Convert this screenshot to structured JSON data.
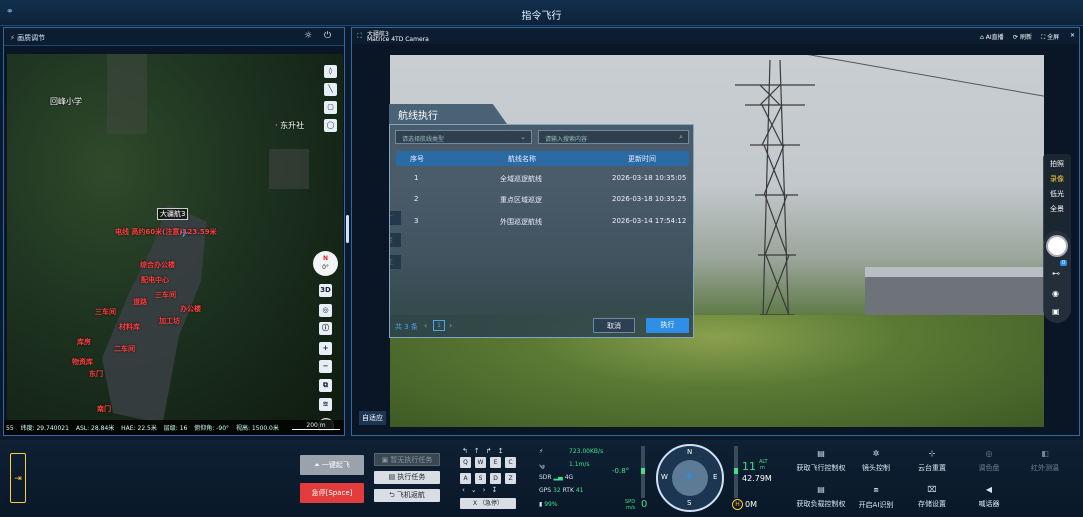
{
  "window": {
    "title": "指令飞行"
  },
  "map_panel": {
    "header_label": "画质调节",
    "labels": {
      "school": "回峰小学",
      "east": "· 东升社",
      "drone": "大疆航3",
      "power_line": "电线 高约60米(注意)123.59米",
      "office": "综合办公楼",
      "distribution": "配电中心",
      "water": "三车间",
      "material": "材料库",
      "tech": "加工坊",
      "admin": "办公楼",
      "warehouse": "库房",
      "road": "道路",
      "park": "二车间",
      "workshop": "三车间",
      "east_gate": "东门",
      "depot": "物资库",
      "south": "南门"
    },
    "compass": {
      "dir": "N",
      "deg": "0°"
    },
    "tools": {
      "three_d": "3D"
    },
    "status": {
      "prefix": "55",
      "lat": "纬度: 29.740021",
      "asl": "ASL: 28.84米",
      "hae": "HAE: 22.5米",
      "level": "层级: 16",
      "pitch": "俯仰角: -90°",
      "range": "视高: 1500.0米",
      "scale": "200 m"
    }
  },
  "camera_panel": {
    "drone_name": "大疆航3",
    "camera_name": "Matrice 4TD Camera",
    "actions": {
      "ai_live": "AI直播",
      "refresh": "刷新",
      "fullscreen": "全屏"
    },
    "side_labels": [
      "广",
      "变",
      "红"
    ],
    "adaptive": "自适应"
  },
  "dialog": {
    "title": "航线执行",
    "type_placeholder": "请选择航线类型",
    "search_placeholder": "请输入搜索内容",
    "columns": [
      "序号",
      "航线名称",
      "更新时间"
    ],
    "rows": [
      [
        "1",
        "全域巡逻航线",
        "2026-03-18 10:35:05"
      ],
      [
        "2",
        "重点区域巡逻",
        "2026-03-18 10:35:25"
      ],
      [
        "3",
        "外围巡逻航线",
        "2026-03-14 17:54:12"
      ]
    ],
    "total": "共 3 条",
    "page": "1",
    "cancel": "取消",
    "execute": "执行"
  },
  "camera_modes": {
    "items": [
      "拍照",
      "录像",
      "低光",
      "全景"
    ],
    "active": "录像",
    "zoom_badge": "0"
  },
  "bottom": {
    "takeoff": "一键起飞",
    "emergency": "急停[Space]",
    "pause_task": "暂无执行任务",
    "exec_task": "执行任务",
    "return": "飞机返航",
    "keys": {
      "row1": [
        "Q",
        "W",
        "E",
        "C"
      ],
      "row2": [
        "A",
        "S",
        "D",
        "Z"
      ],
      "x_label": "X （急停）"
    },
    "telemetry": {
      "speed": "723.00KB/s",
      "wind": "1.1m/s",
      "sdr": "SDR",
      "net": "4G",
      "gps": "GPS",
      "gps_count": "32",
      "rtk": "RTK",
      "rtk_count": "41",
      "battery": "99%"
    },
    "attitude": {
      "pitch": "-0.8°",
      "spd_label": "SPD",
      "spd_unit": "m/s",
      "spd": "0",
      "alt": "11",
      "alt_label": "ALT",
      "alt_unit": "m",
      "distance": "42.79M",
      "home": "0M",
      "compass_letters": [
        "N",
        "E",
        "S",
        "W"
      ]
    },
    "controls": [
      {
        "label": "获取飞行控制权",
        "dim": false,
        "icon": "▤"
      },
      {
        "label": "镜头控制",
        "dim": false,
        "icon": "✲"
      },
      {
        "label": "云台重置",
        "dim": false,
        "icon": "⊹"
      },
      {
        "label": "调色盘",
        "dim": true,
        "icon": "◎"
      },
      {
        "label": "红外测温",
        "dim": true,
        "icon": "◧"
      },
      {
        "label": "获取负载控制权",
        "dim": false,
        "icon": "▤"
      },
      {
        "label": "开启AI识别",
        "dim": false,
        "icon": "⧈"
      },
      {
        "label": "存储设置",
        "dim": false,
        "icon": "⌧"
      },
      {
        "label": "喊话器",
        "dim": false,
        "icon": "◀"
      }
    ]
  },
  "colors": {
    "accent": "#2f8fe8",
    "danger": "#e23c3c",
    "ok": "#3fe08a",
    "frame": "#2e6aa0"
  }
}
